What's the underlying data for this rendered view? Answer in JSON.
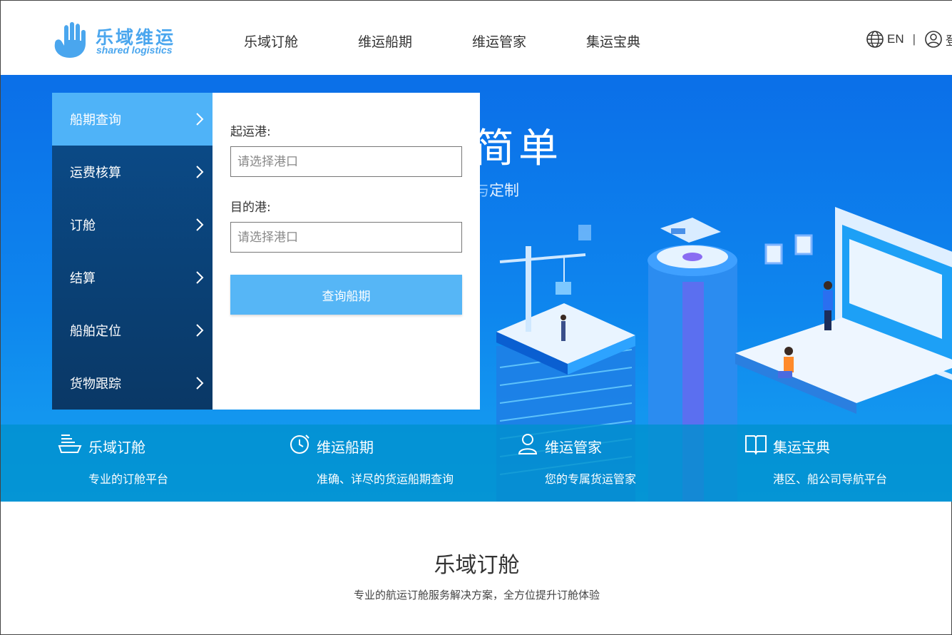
{
  "header": {
    "logo_title": "乐域维运",
    "logo_subtitle": "shared logistics",
    "nav": [
      "乐域订舱",
      "维运船期",
      "维运管家",
      "集运宝典"
    ],
    "lang": "EN",
    "login": "登"
  },
  "hero": {
    "title_partial": "简单",
    "subtitle_partial": "定制"
  },
  "menu": {
    "items": [
      "船期查询",
      "运费核算",
      "订舱",
      "结算",
      "船舶定位",
      "货物跟踪"
    ],
    "active_index": 0
  },
  "search": {
    "origin_label": "起运港:",
    "origin_placeholder": "请选择港口",
    "dest_label": "目的港:",
    "dest_placeholder": "请选择港口",
    "button": "查询船期"
  },
  "features": [
    {
      "icon": "ship-icon",
      "title": "乐域订舱",
      "desc": "专业的订舱平台"
    },
    {
      "icon": "clock-icon",
      "title": "维运船期",
      "desc": "准确、详尽的货运船期查询"
    },
    {
      "icon": "user-icon",
      "title": "维运管家",
      "desc": "您的专属货运管家"
    },
    {
      "icon": "book-icon",
      "title": "集运宝典",
      "desc": "港区、船公司导航平台"
    }
  ],
  "section": {
    "title": "乐域订舱",
    "subtitle": "专业的航运订舱服务解决方案，全方位提升订舱体验"
  },
  "colors": {
    "brand": "#4aa6ee",
    "menu_dark": "#0a3866",
    "menu_active": "#4fb3f8",
    "button": "#56b6f6"
  }
}
